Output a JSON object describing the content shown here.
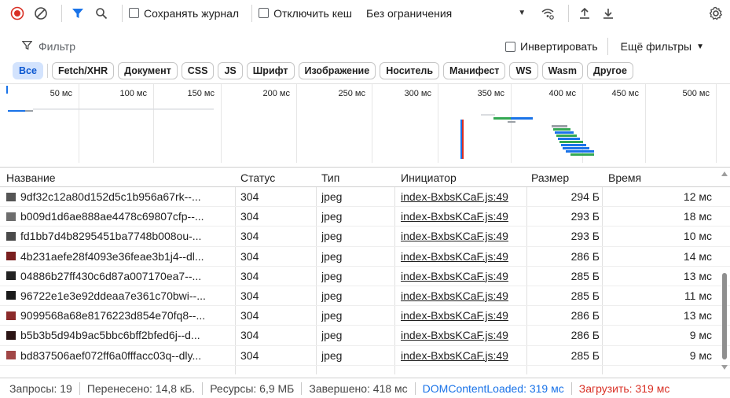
{
  "toolbar": {
    "preserve_log_label": "Сохранять журнал",
    "disable_cache_label": "Отключить кеш",
    "throttling_value": "Без ограничения",
    "icons": [
      "record-stop-icon",
      "clear-icon",
      "filter-icon",
      "search-icon",
      "wifi-settings-icon",
      "upload-icon",
      "download-icon",
      "gear-icon"
    ]
  },
  "filter": {
    "placeholder": "Фильтр",
    "invert_label": "Инвертировать",
    "more_filters_label": "Ещё фильтры"
  },
  "type_chips": [
    "Все",
    "Fetch/XHR",
    "Документ",
    "CSS",
    "JS",
    "Шрифт",
    "Изображение",
    "Носитель",
    "Манифест",
    "WS",
    "Wasm",
    "Другое"
  ],
  "overview": {
    "ticks": [
      "50 мс",
      "100 мс",
      "150 мс",
      "200 мс",
      "250 мс",
      "300 мс",
      "350 мс",
      "400 мс",
      "450 мс",
      "500 мс"
    ],
    "dom_content_loaded_ms": 319,
    "load_ms": 319
  },
  "table": {
    "headers": {
      "name": "Название",
      "status": "Статус",
      "type": "Тип",
      "initiator": "Инициатор",
      "size": "Размер",
      "time": "Время"
    },
    "rows": [
      {
        "name": "9df32c12a80d152d5c1b956a67rk--...",
        "status": "304",
        "type": "jpeg",
        "initiator": "index-BxbsKCaF.js:49",
        "size": "294 Б",
        "time": "12 мс",
        "thumb": "#555555"
      },
      {
        "name": "b009d1d6ae888ae4478c69807cfp--...",
        "status": "304",
        "type": "jpeg",
        "initiator": "index-BxbsKCaF.js:49",
        "size": "293 Б",
        "time": "18 мс",
        "thumb": "#6d6d6d"
      },
      {
        "name": "fd1bb7d4b8295451ba7748b008ou-...",
        "status": "304",
        "type": "jpeg",
        "initiator": "index-BxbsKCaF.js:49",
        "size": "293 Б",
        "time": "10 мс",
        "thumb": "#4a4a4a"
      },
      {
        "name": "4b231aefe28f4093e36feae3b1j4--dl...",
        "status": "304",
        "type": "jpeg",
        "initiator": "index-BxbsKCaF.js:49",
        "size": "286 Б",
        "time": "14 мс",
        "thumb": "#7a1f1f"
      },
      {
        "name": "04886b27ff430c6d87a007170ea7--...",
        "status": "304",
        "type": "jpeg",
        "initiator": "index-BxbsKCaF.js:49",
        "size": "285 Б",
        "time": "13 мс",
        "thumb": "#222222"
      },
      {
        "name": "96722e1e3e92ddeaa7e361c70bwi--...",
        "status": "304",
        "type": "jpeg",
        "initiator": "index-BxbsKCaF.js:49",
        "size": "285 Б",
        "time": "11 мс",
        "thumb": "#1a1a1a"
      },
      {
        "name": "9099568a68e8176223d854e70fq8--...",
        "status": "304",
        "type": "jpeg",
        "initiator": "index-BxbsKCaF.js:49",
        "size": "286 Б",
        "time": "13 мс",
        "thumb": "#8b2a2a"
      },
      {
        "name": "b5b3b5d94b9ac5bbc6bff2bfed6j--d...",
        "status": "304",
        "type": "jpeg",
        "initiator": "index-BxbsKCaF.js:49",
        "size": "286 Б",
        "time": "9 мс",
        "thumb": "#2b1414"
      },
      {
        "name": "bd837506aef072ff6a0fffacc03q--dly...",
        "status": "304",
        "type": "jpeg",
        "initiator": "index-BxbsKCaF.js:49",
        "size": "285 Б",
        "time": "9 мс",
        "thumb": "#a14646"
      }
    ]
  },
  "statusbar": {
    "requests": "Запросы: 19",
    "transferred": "Перенесено: 14,8 кБ.",
    "resources": "Ресурсы: 6,9 МБ",
    "finished": "Завершено: 418 мс",
    "dom_content_loaded": "DOMContentLoaded: 319 мс",
    "load": "Загрузить: 319 мс"
  },
  "colors": {
    "record_red": "#d93025",
    "filter_blue": "#1a73e8",
    "chip_active_bg": "#d3e3fd",
    "dcl_blue": "#1a73e8",
    "load_red": "#d93025"
  }
}
